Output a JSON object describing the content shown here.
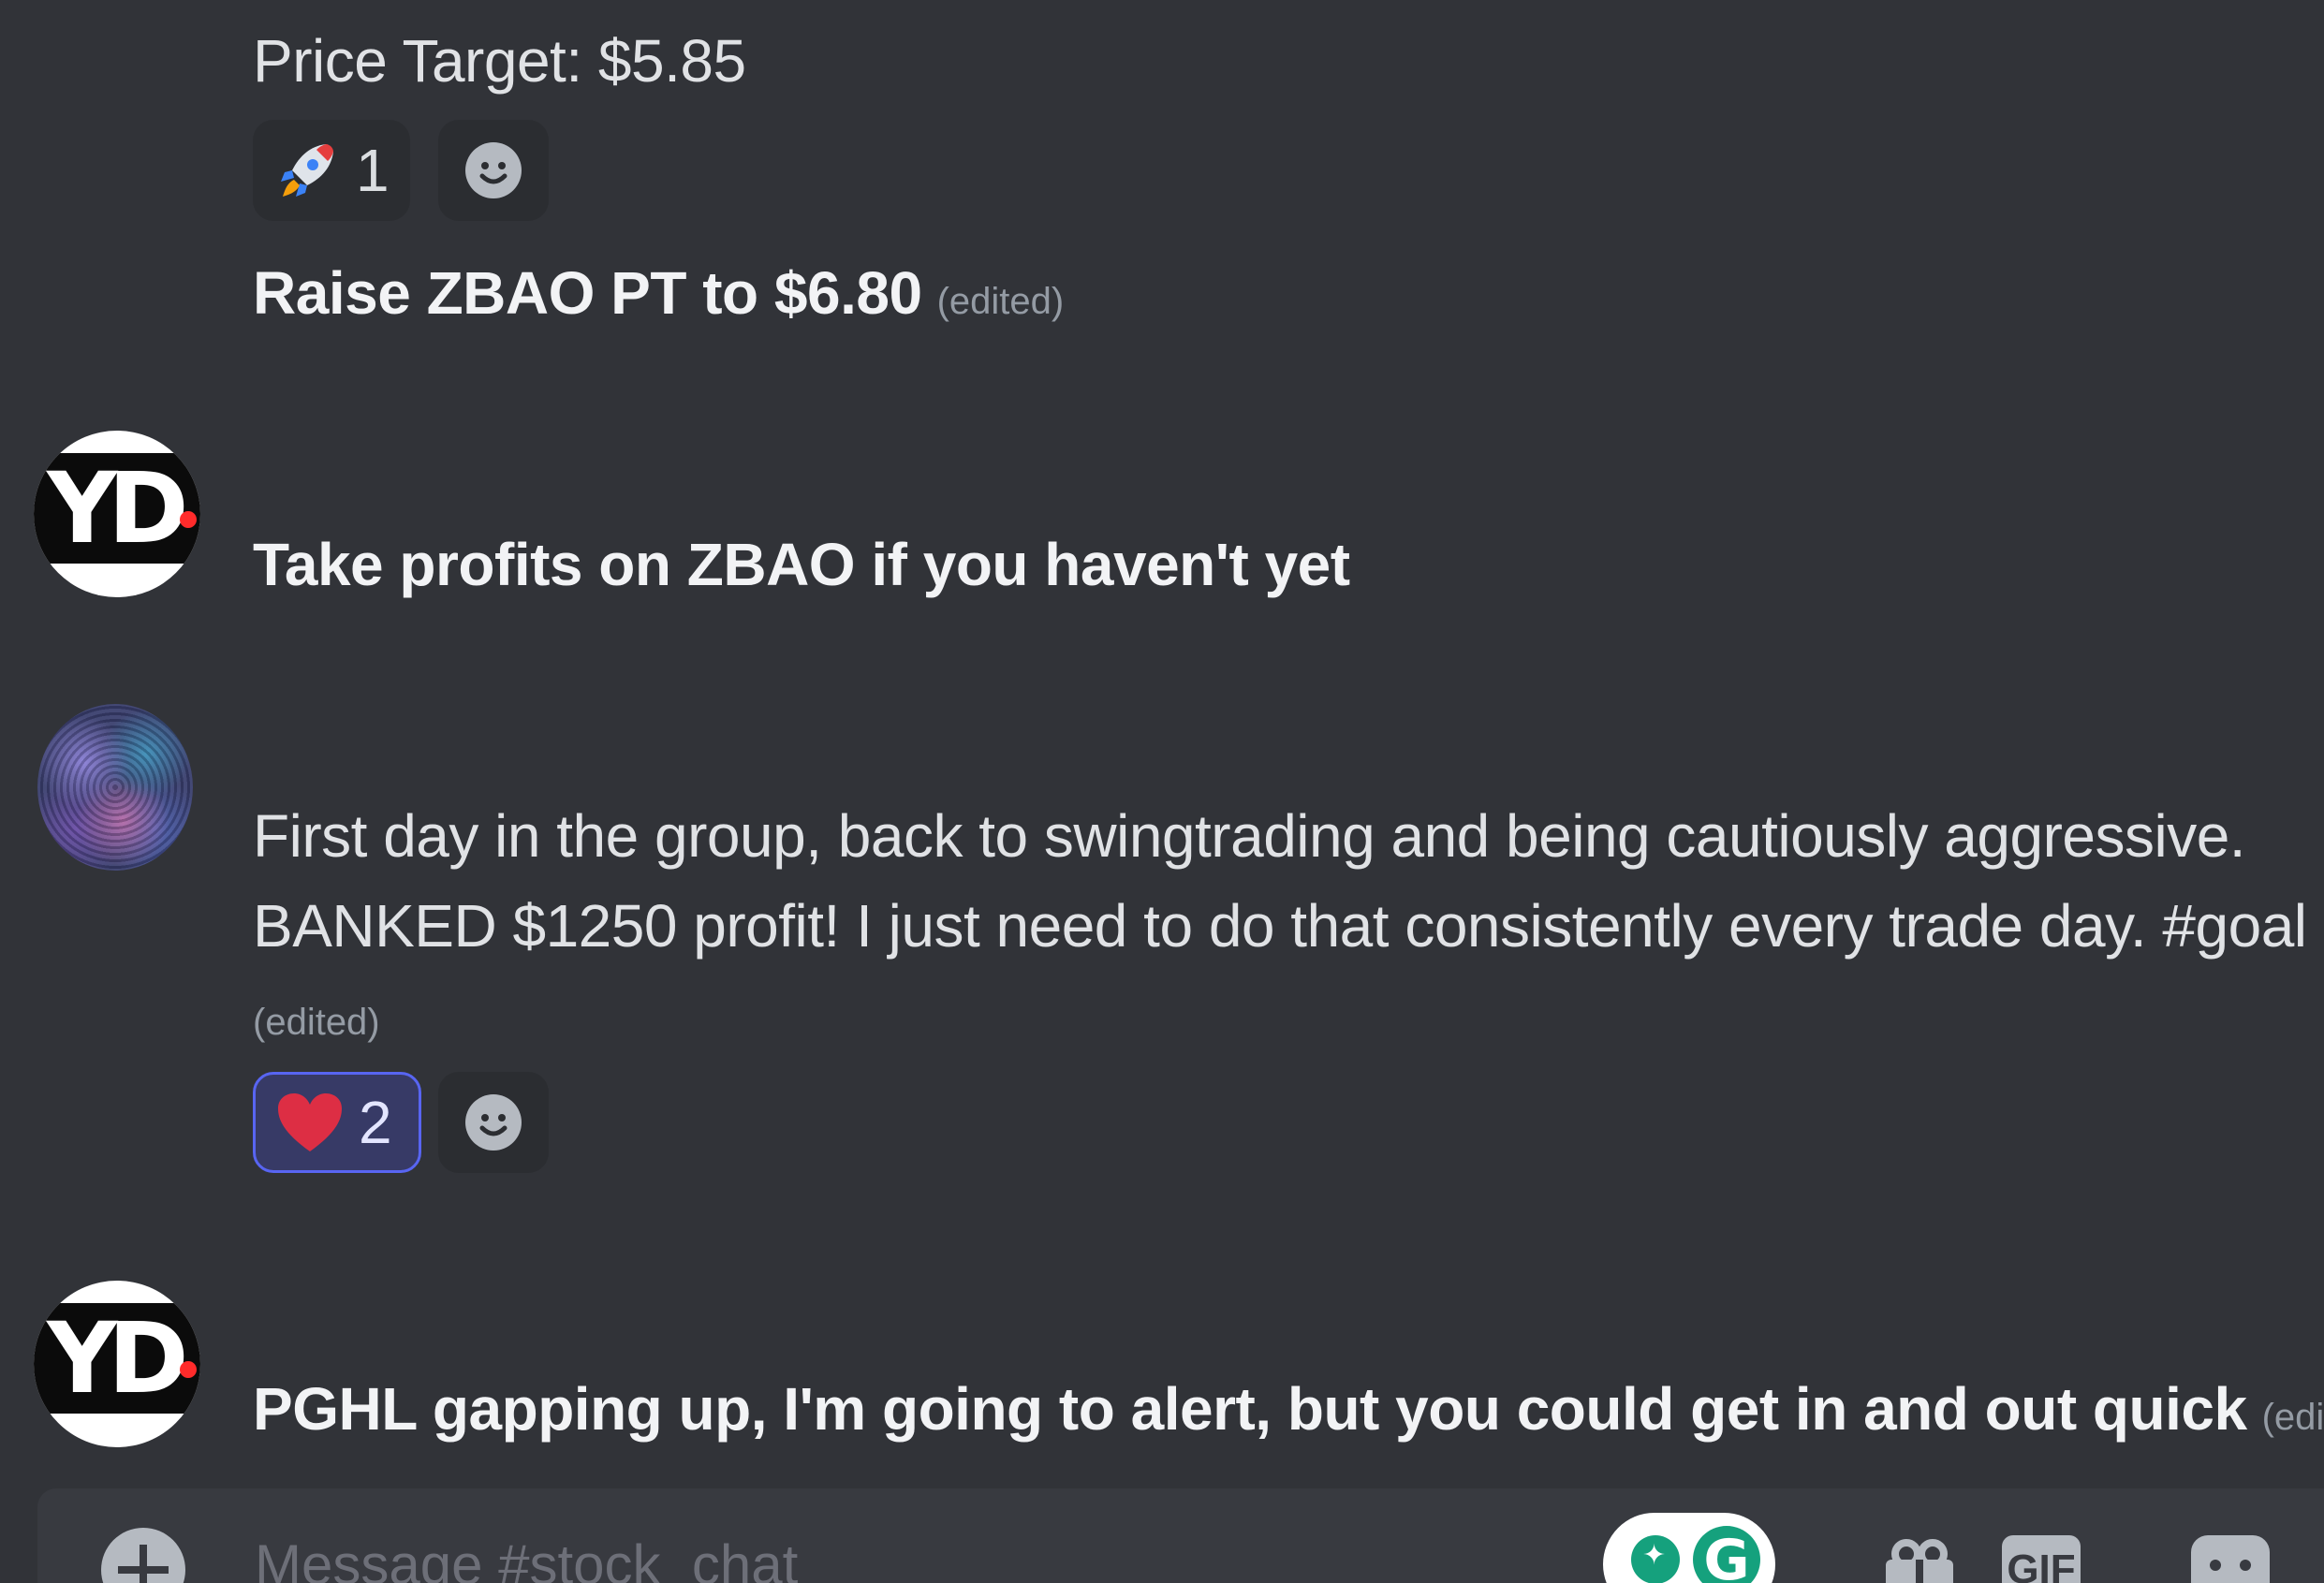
{
  "messages": [
    {
      "text": "Price Target: $5.85",
      "reactions": [
        {
          "emoji_icon": "rocket-icon",
          "count": "1"
        }
      ]
    },
    {
      "text": "Raise ZBAO PT to $6.80",
      "edited": "(edited)"
    },
    {
      "avatar_icon": "yd-logo-avatar",
      "text": "Take profits on ZBAO if you haven't yet"
    },
    {
      "avatar_icon": "nebula-photo-avatar",
      "text_line1": "First day in the group, back to swingtrading and being cautiously aggressive.",
      "text_line2": "BANKED $1250 profit!  I just need to do that  consistently every trade day. #goal",
      "edited": "(edited)",
      "reactions": [
        {
          "emoji_icon": "heart-icon",
          "count": "2",
          "active": true
        }
      ]
    },
    {
      "avatar_icon": "yd-logo-avatar",
      "text": "PGHL gapping up, I'm going to alert, but you could get in and out quick",
      "edited": "(edited)"
    }
  ],
  "avatar_logo_text": "YD",
  "composer": {
    "placeholder": "Message #stock_chat",
    "grammarly_letter": "G",
    "gif_label": "GIF"
  },
  "colors": {
    "background": "#313338",
    "composer": "#383a40",
    "text": "#dbdee1",
    "muted": "#949ba4",
    "reaction_active_border": "#5865f2",
    "grammarly_green": "#15a17d"
  }
}
